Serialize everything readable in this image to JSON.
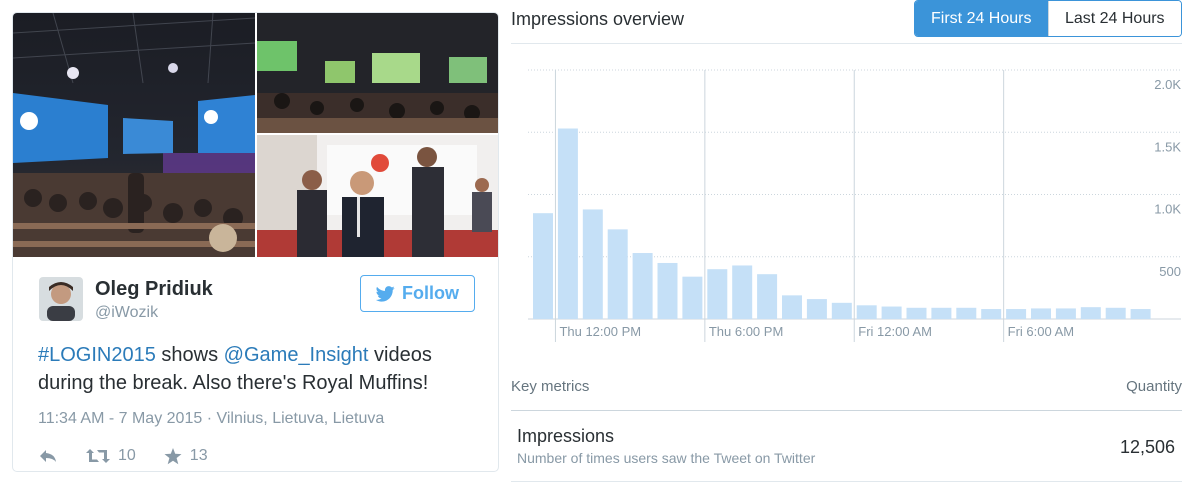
{
  "tweet": {
    "user": {
      "display_name": "Oleg Pridiuk",
      "handle": "@iWozik"
    },
    "follow_label": "Follow",
    "text": {
      "hashtag": "#LOGIN2015",
      "part1": " shows ",
      "mention": "@Game_Insight",
      "part2": " videos during the break. Also there's Royal Muffins!"
    },
    "meta": "11:34 AM - 7 May 2015 · Vilnius, Lietuva, Lietuva",
    "retweets": "10",
    "favorites": "13",
    "photos": [
      {
        "icon": "conference-hall-photo"
      },
      {
        "icon": "screens-photo"
      },
      {
        "icon": "attendees-photo"
      }
    ]
  },
  "analytics": {
    "title": "Impressions overview",
    "toggle": {
      "first": "First 24 Hours",
      "last": "Last 24 Hours",
      "selected": "first"
    },
    "metrics_header": {
      "label": "Key metrics",
      "quantity": "Quantity"
    },
    "metrics": [
      {
        "name": "Impressions",
        "description": "Number of times users saw the Tweet on Twitter",
        "value": "12,506"
      }
    ]
  },
  "colors": {
    "accent": "#3b94d9",
    "link": "#2b7bb9",
    "bar": "#c5e0f7"
  },
  "chart_data": {
    "type": "bar",
    "title": "",
    "ylim": [
      0,
      2000
    ],
    "y_ticks": [
      "500",
      "1.0K",
      "1.5K",
      "2.0K"
    ],
    "y_tick_values": [
      500,
      1000,
      1500,
      2000
    ],
    "x_labels": [
      "Thu 12:00 PM",
      "Thu 6:00 PM",
      "Fri 12:00 AM",
      "Fri 6:00 AM"
    ],
    "x_label_after_bar": [
      1,
      7,
      13,
      19
    ],
    "grid": true,
    "series": [
      {
        "values": [
          850,
          1530,
          880,
          720,
          530,
          450,
          340,
          400,
          430,
          360,
          190,
          160,
          130,
          110,
          100,
          90,
          90,
          90,
          80,
          80,
          85,
          85,
          95,
          90,
          80
        ]
      }
    ]
  }
}
